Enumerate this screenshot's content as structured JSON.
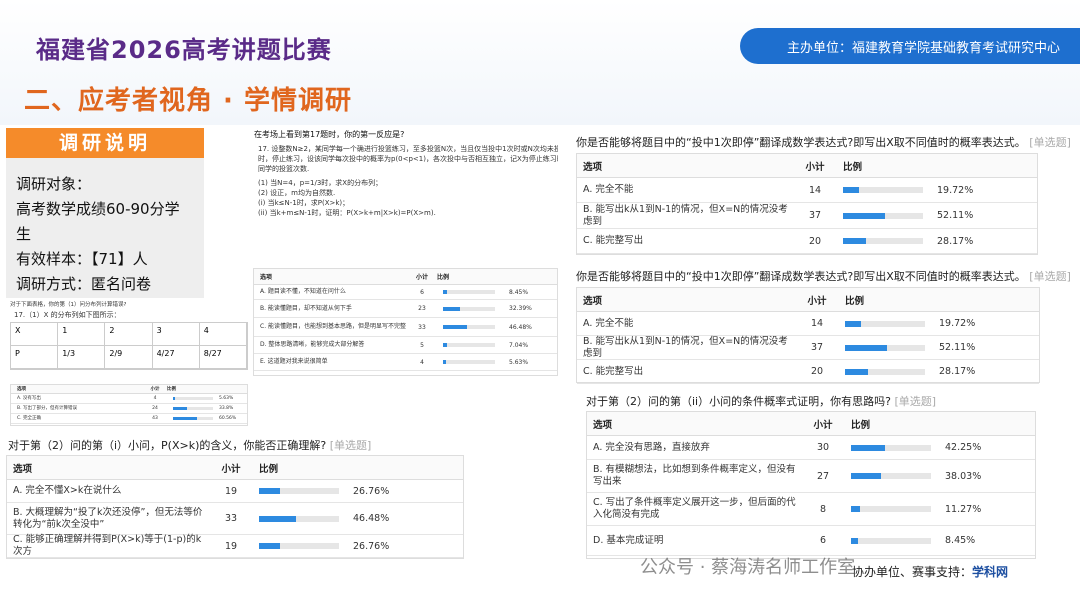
{
  "header": {
    "title": "福建省2026高考讲题比赛",
    "organizer": "主办单位：福建教育学院基础教育考试研究中心",
    "subtitle": "二、应考者视角 · 学情调研"
  },
  "survey": {
    "tag": "调研说明",
    "lines": [
      "调研对象：",
      "高考数学成绩60-90分学",
      "生",
      "有效样本：【71】人",
      "调研方式：匿名问卷"
    ]
  },
  "doc": {
    "q": "在考场上看到第17题时，你的第一反应是?",
    "lines": [
      "17. 设整数N≥2，某同学每一个确进行投篮练习，至多投篮N次，当且仅当投中1次时或N次均未投中",
      "时，停止练习，设该同学每次投中的概率为p(0<p<1)，各次投中与否相互独立，记X为停止练习时投篮",
      "同学的投篮次数.",
      "(1) 当N=4，p=1/3时，求X的分布列；",
      "(2) 设正，m均为自然数.",
      "(i) 当k≤N-1时，求P(X>k)；",
      "(ii) 当k+m≤N-1时，证明：P(X>k+m|X>k)=P(X>m)."
    ],
    "table": {
      "h": [
        "选项",
        "小计",
        "比例"
      ],
      "rows": [
        {
          "o": "A. 题目读不懂，不知道在问什么",
          "n": "6",
          "p": "8.45%",
          "v": 0.0845
        },
        {
          "o": "B. 能读懂题目，却不知道从何下手",
          "n": "23",
          "p": "32.39%",
          "v": 0.3239
        },
        {
          "o": "C. 能读懂题目，也能想到基本思路，但是明显写不完整",
          "n": "33",
          "p": "46.48%",
          "v": 0.4648
        },
        {
          "o": "D. 整体思路清晰，能够完成大部分解答",
          "n": "5",
          "p": "7.04%",
          "v": 0.0704
        },
        {
          "o": "E. 这道题对我来说很简单",
          "n": "4",
          "p": "5.63%",
          "v": 0.0563
        }
      ]
    },
    "q2": "对于下面表格，你的第（1）问分布列计算错误?",
    "q3": "17.（1）X 的分布列如下图所示：",
    "dist": [
      [
        "X",
        "1",
        "2",
        "3",
        "4"
      ],
      [
        "P",
        "1/3",
        "2/9",
        "4/27",
        "8/27"
      ]
    ],
    "minitable": {
      "h": [
        "选项",
        "小计",
        "比例"
      ],
      "rows": [
        {
          "o": "A. 没有写出",
          "n": "4",
          "p": "5.63%",
          "v": 0.0563
        },
        {
          "o": "B. 写出了部分，但有计算错误",
          "n": "24",
          "p": "33.8%",
          "v": 0.338
        },
        {
          "o": "C. 完全正确",
          "n": "43",
          "p": "60.56%",
          "v": 0.6056
        }
      ]
    }
  },
  "left": {
    "q": "对于第（2）问的第（i）小问，P(X>k)的含义，你能否正确理解?",
    "tag": "[单选题]",
    "h": [
      "选项",
      "小计",
      "比例"
    ],
    "rows": [
      {
        "o": "A. 完全不懂X>k在说什么",
        "n": "19",
        "p": "26.76%",
        "v": 0.2676
      },
      {
        "o": "B. 大概理解为“投了k次还没停”，但无法等价转化为“前k次全没中”",
        "n": "33",
        "p": "46.48%",
        "v": 0.4648
      },
      {
        "o": "C. 能够正确理解并得到P(X>k)等于(1-p)的k次方",
        "n": "19",
        "p": "26.76%",
        "v": 0.2676
      }
    ]
  },
  "right1": {
    "q": "你是否能够将题目中的“投中1次即停”翻译成数学表达式?即写出X取不同值时的概率表达式。",
    "tag": "[单选题]",
    "h": [
      "选项",
      "小计",
      "比例"
    ],
    "rows": [
      {
        "o": "A. 完全不能",
        "n": "14",
        "p": "19.72%",
        "v": 0.1972
      },
      {
        "o": "B. 能写出k从1到N-1的情况，但X=N的情况没考虑到",
        "n": "37",
        "p": "52.11%",
        "v": 0.5211
      },
      {
        "o": "C. 能完整写出",
        "n": "20",
        "p": "28.17%",
        "v": 0.2817
      }
    ]
  },
  "right2": {
    "q": "你是否能够将题目中的“投中1次即停”翻译成数学表达式?即写出X取不同值时的概率表达式。",
    "tag": "[单选题]",
    "h": [
      "选项",
      "小计",
      "比例"
    ],
    "rows": [
      {
        "o": "A. 完全不能",
        "n": "14",
        "p": "19.72%",
        "v": 0.1972
      },
      {
        "o": "B. 能写出k从1到N-1的情况，但X=N的情况没考虑到",
        "n": "37",
        "p": "52.11%",
        "v": 0.5211
      },
      {
        "o": "C. 能完整写出",
        "n": "20",
        "p": "28.17%",
        "v": 0.2817
      }
    ]
  },
  "right3": {
    "q": "对于第（2）问的第（ii）小问的条件概率式证明，你有思路吗?",
    "tag": "[单选题]",
    "h": [
      "选项",
      "小计",
      "比例"
    ],
    "rows": [
      {
        "o": "A. 完全没有思路，直接放弃",
        "n": "30",
        "p": "42.25%",
        "v": 0.4225
      },
      {
        "o": "B. 有模糊想法，比如想到条件概率定义，但没有写出来",
        "n": "27",
        "p": "38.03%",
        "v": 0.3803
      },
      {
        "o": "C. 写出了条件概率定义展开这一步，但后面的代入化简没有完成",
        "n": "8",
        "p": "11.27%",
        "v": 0.1127
      },
      {
        "o": "D. 基本完成证明",
        "n": "6",
        "p": "8.45%",
        "v": 0.0845
      }
    ]
  },
  "footer": {
    "watermark": "公众号 · 蔡海涛名师工作室",
    "co": "协办单位、赛事支持：",
    "brand": "学科网"
  }
}
